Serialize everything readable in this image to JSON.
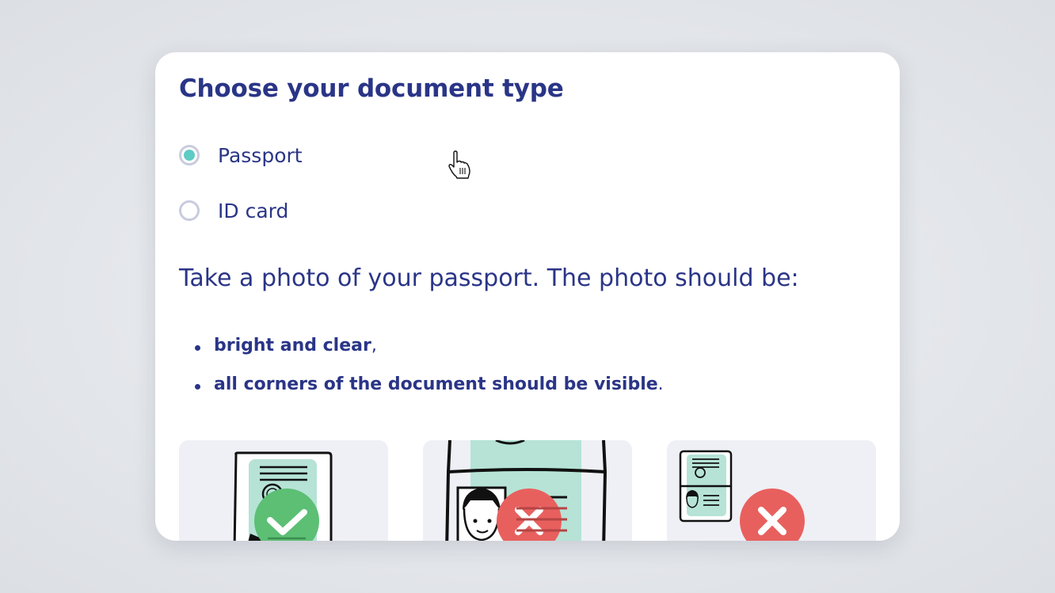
{
  "form": {
    "title": "Choose your document type",
    "options": [
      {
        "label": "Passport",
        "selected": true
      },
      {
        "label": "ID card",
        "selected": false
      }
    ]
  },
  "instructions": {
    "lead": "Take a photo of your passport. The photo should be:",
    "bullets": [
      {
        "bold": "bright and clear",
        "suffix": ","
      },
      {
        "bold": "all corners of the document should be visible",
        "suffix": "."
      }
    ]
  },
  "examples": [
    {
      "icon": "check-icon",
      "status": "good"
    },
    {
      "icon": "cross-icon",
      "status": "bad"
    },
    {
      "icon": "cross-icon",
      "status": "bad"
    }
  ],
  "colors": {
    "text": "#2a3587",
    "radio_selected": "#5ecbc4",
    "radio_border": "#c9cbde",
    "tile_bg": "#eff0f6",
    "good": "#5cbf74",
    "bad": "#e8605e",
    "doc_page": "#b6e3d6"
  }
}
